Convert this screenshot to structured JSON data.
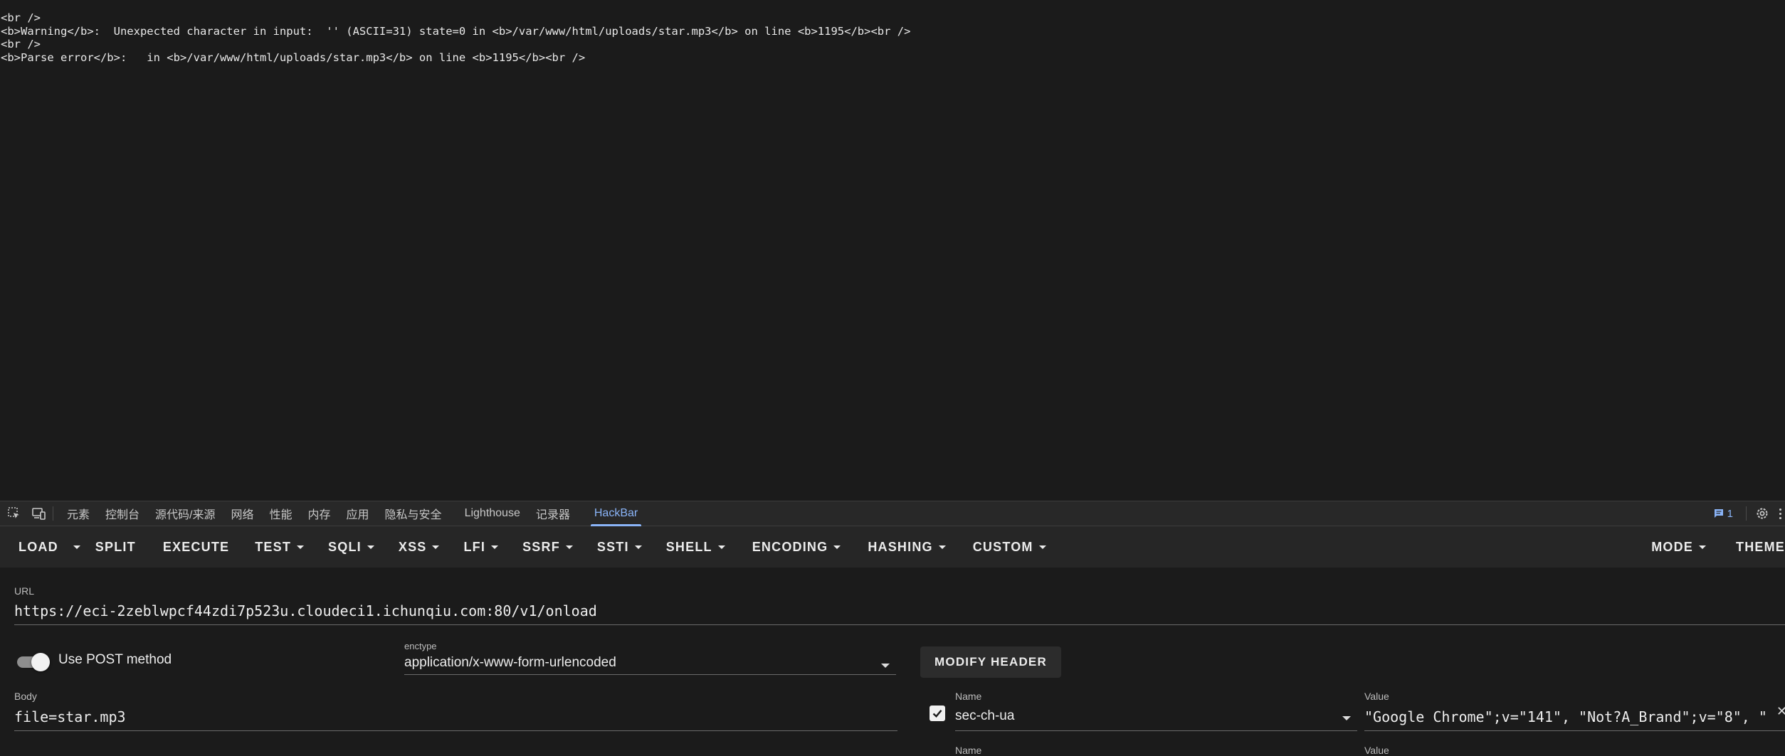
{
  "page_output": {
    "lines": [
      "<br />",
      "<b>Warning</b>:  Unexpected character in input:  '\u001f' (ASCII=31) state=0 in <b>/var/www/html/uploads/star.mp3</b> on line <b>1195</b><br />",
      "<br />",
      "<b>Parse error</b>:   in <b>/var/www/html/uploads/star.mp3</b> on line <b>1195</b><br />"
    ]
  },
  "devtools": {
    "tabs": [
      "元素",
      "控制台",
      "源代码/来源",
      "网络",
      "性能",
      "内存",
      "应用",
      "隐私与安全",
      "Lighthouse",
      "记录器",
      "HackBar"
    ],
    "active_tab": "HackBar",
    "issues_count": "1",
    "accent_color": "#8ab4f8"
  },
  "hackbar": {
    "menu": {
      "load": "LOAD",
      "split": "SPLIT",
      "execute": "EXECUTE",
      "test": "TEST",
      "sqli": "SQLI",
      "xss": "XSS",
      "lfi": "LFI",
      "ssrf": "SSRF",
      "ssti": "SSTI",
      "shell": "SHELL",
      "encoding": "ENCODING",
      "hashing": "HASHING",
      "custom": "CUSTOM",
      "mode": "MODE",
      "theme": "THEME"
    },
    "url_label": "URL",
    "url_value": "https://eci-2zeblwpcf44zdi7p523u.cloudeci1.ichunqiu.com:80/v1/onload",
    "post_label": "Use POST method",
    "post_enabled": true,
    "enctype_label": "enctype",
    "enctype_value": "application/x-www-form-urlencoded",
    "modify_header_label": "MODIFY HEADER",
    "body_label": "Body",
    "body_value": "file=star.mp3",
    "headers": [
      {
        "enabled": true,
        "name_label": "Name",
        "name": "sec-ch-ua",
        "value_label": "Value",
        "value": "\"Google Chrome\";v=\"141\", \"Not?A_Brand\";v=\"8\", \""
      },
      {
        "name_label": "Name",
        "value_label": "Value"
      }
    ]
  }
}
